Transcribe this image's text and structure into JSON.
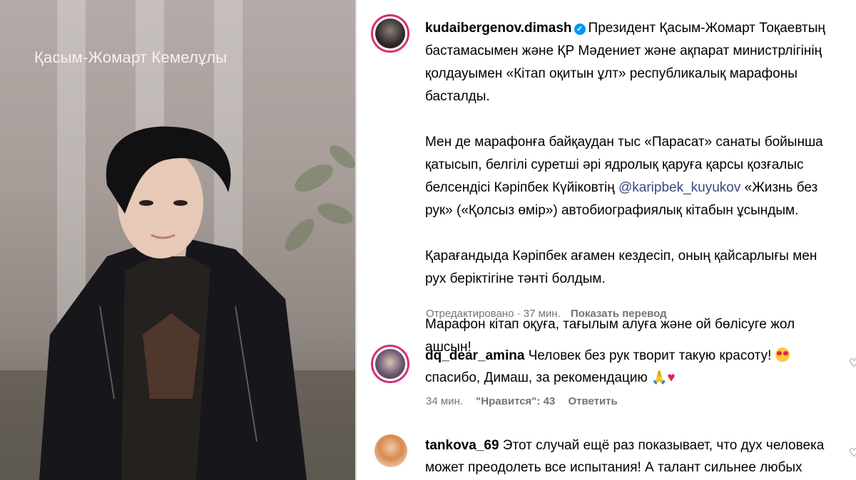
{
  "photo": {
    "overlay_title": "Қасым-Жомарт Кемелұлы"
  },
  "post": {
    "username": "kudaibergenov.dimash",
    "verified_icon": "verified-badge-icon",
    "paragraph_1_text": "Президент Қасым-Жомарт Тоқаевтың бастамасымен және ҚР Мәдениет және ақпарат министрлігінің қолдауымен «Кітап оқитын ұлт» республикалық марафоны басталды.",
    "paragraph_2_before": "Мен де марафонға байқаудан тыс «Парасат» санаты бойынша қатысып, белгілі суретші әрі ядролық қаруға қарсы қозғалыс белсендісі Кәріпбек Күйіковтің ",
    "paragraph_2_mention": "@karipbek_kuyukov",
    "paragraph_2_after": " «Жизнь без рук» («Қолсыз өмір») автобиографиялық кітабын ұсындым.",
    "paragraph_3": "Қарағандыда Кәріпбек ағамен кездесіп, оның қайсарлығы мен рух беріктігіне тәнті болдым.",
    "paragraph_4": "Марафон кітап оқуға, тағылым алуға және ой бөлісуге жол ашсын!",
    "edited_label": "Отредактировано",
    "separator": "·",
    "time": "37 мин.",
    "translate_label": "Показать перевод"
  },
  "comments": [
    {
      "username": "dq_dear_amina",
      "text_1": "Человек без рук творит такую красоту!",
      "text_2": "спасибо, Димаш, за рекомендацию",
      "time": "34 мин.",
      "likes": "\"Нравится\": 43",
      "reply_label": "Ответить"
    },
    {
      "username": "tankova_69",
      "text": "Этот случай ещё раз показывает, что дух человека может преодолеть все испытания! А талант сильнее любых физических недостатков! Наш Ди, таким"
    }
  ],
  "colors": {
    "avatar_ring": "#d62e76",
    "mention": "#374a7e",
    "verified": "#0095f6",
    "meta_text": "#737373"
  }
}
